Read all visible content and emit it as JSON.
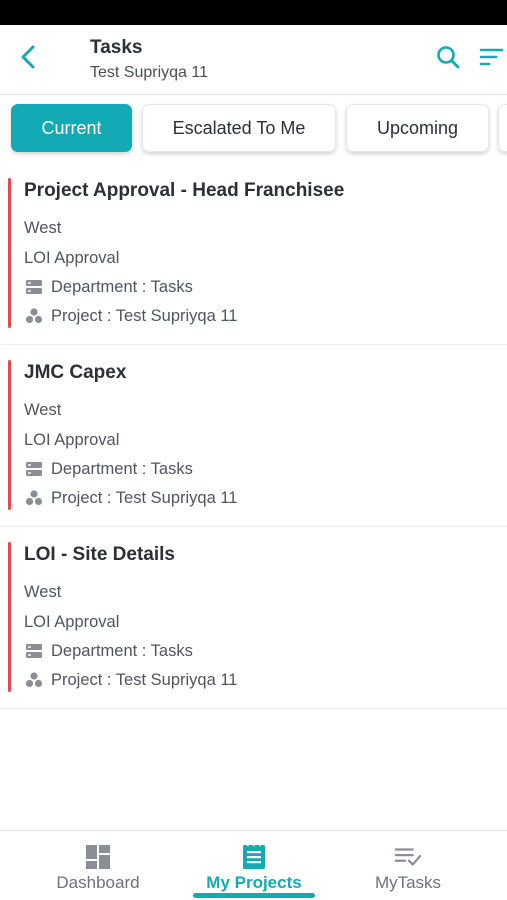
{
  "header": {
    "title": "Tasks",
    "subtitle": "Test Supriyqa 11",
    "icons": {
      "back": "back-arrow-icon",
      "search": "search-icon",
      "filter": "filter-icon"
    },
    "accent": "#12aab5"
  },
  "tabs": [
    {
      "label": "Current",
      "active": true
    },
    {
      "label": "Escalated To Me",
      "active": false
    },
    {
      "label": "Upcoming",
      "active": false
    }
  ],
  "tasks": [
    {
      "title": "Project Approval - Head Franchisee",
      "region": "West",
      "stage": "LOI Approval",
      "department": "Department : Tasks",
      "project": "Project : Test Supriyqa 11"
    },
    {
      "title": "JMC Capex",
      "region": "West",
      "stage": "LOI Approval",
      "department": "Department : Tasks",
      "project": "Project : Test Supriyqa 11"
    },
    {
      "title": "LOI - Site Details",
      "region": "West",
      "stage": "LOI Approval",
      "department": "Department : Tasks",
      "project": "Project : Test Supriyqa 11"
    }
  ],
  "task_status_color": "#e5484d",
  "bottom_nav": [
    {
      "label": "Dashboard",
      "icon": "dashboard-icon",
      "active": false
    },
    {
      "label": "My Projects",
      "icon": "projects-icon",
      "active": true
    },
    {
      "label": "MyTasks",
      "icon": "mytasks-icon",
      "active": false
    }
  ]
}
